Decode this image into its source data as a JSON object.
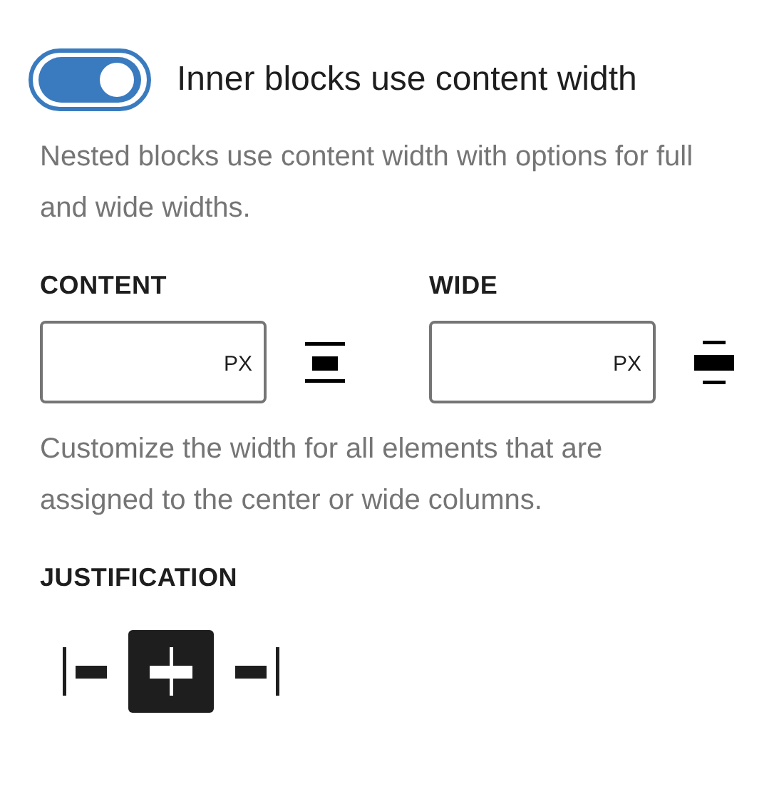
{
  "toggle": {
    "label": "Inner blocks use content width",
    "on": true
  },
  "toggle_help": "Nested blocks use content width with options for full and wide widths.",
  "width_fields": [
    {
      "kind": "content",
      "label": "CONTENT",
      "unit": "PX"
    },
    {
      "kind": "wide",
      "label": "WIDE",
      "unit": "PX"
    }
  ],
  "width_help": "Customize the width for all elements that are assigned to the center or wide columns.",
  "justification": {
    "label": "JUSTIFICATION",
    "options": [
      {
        "kind": "left",
        "selected": false
      },
      {
        "kind": "center",
        "selected": true
      },
      {
        "kind": "right",
        "selected": false
      }
    ]
  }
}
